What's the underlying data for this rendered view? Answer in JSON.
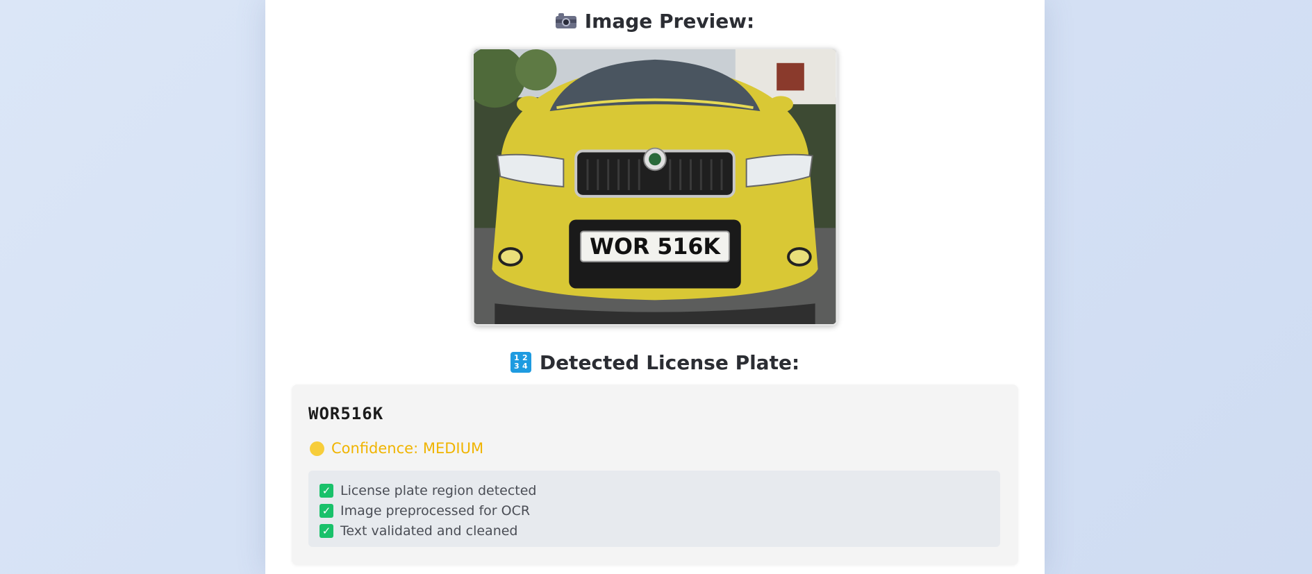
{
  "preview": {
    "title": "Image Preview:",
    "icon": "camera-icon",
    "image_description_icon": "car-photo"
  },
  "plate_section": {
    "title": "Detected License Plate:",
    "icon": "input-numbers-icon",
    "icon_glyphs": [
      "1",
      "2",
      "3",
      "4"
    ]
  },
  "photo": {
    "plate_text": "WOR 516K"
  },
  "result": {
    "plate": "WOR516K",
    "confidence_label": "Confidence: MEDIUM",
    "confidence_color": "#f0b400",
    "checks": [
      {
        "icon": "check-icon",
        "label": "License plate region detected"
      },
      {
        "icon": "check-icon",
        "label": "Image preprocessed for OCR"
      },
      {
        "icon": "check-icon",
        "label": "Text validated and cleaned"
      }
    ]
  },
  "colors": {
    "check_green": "#19c16a",
    "card_bg": "#ffffff",
    "page_bg": "#dbe6f7"
  }
}
